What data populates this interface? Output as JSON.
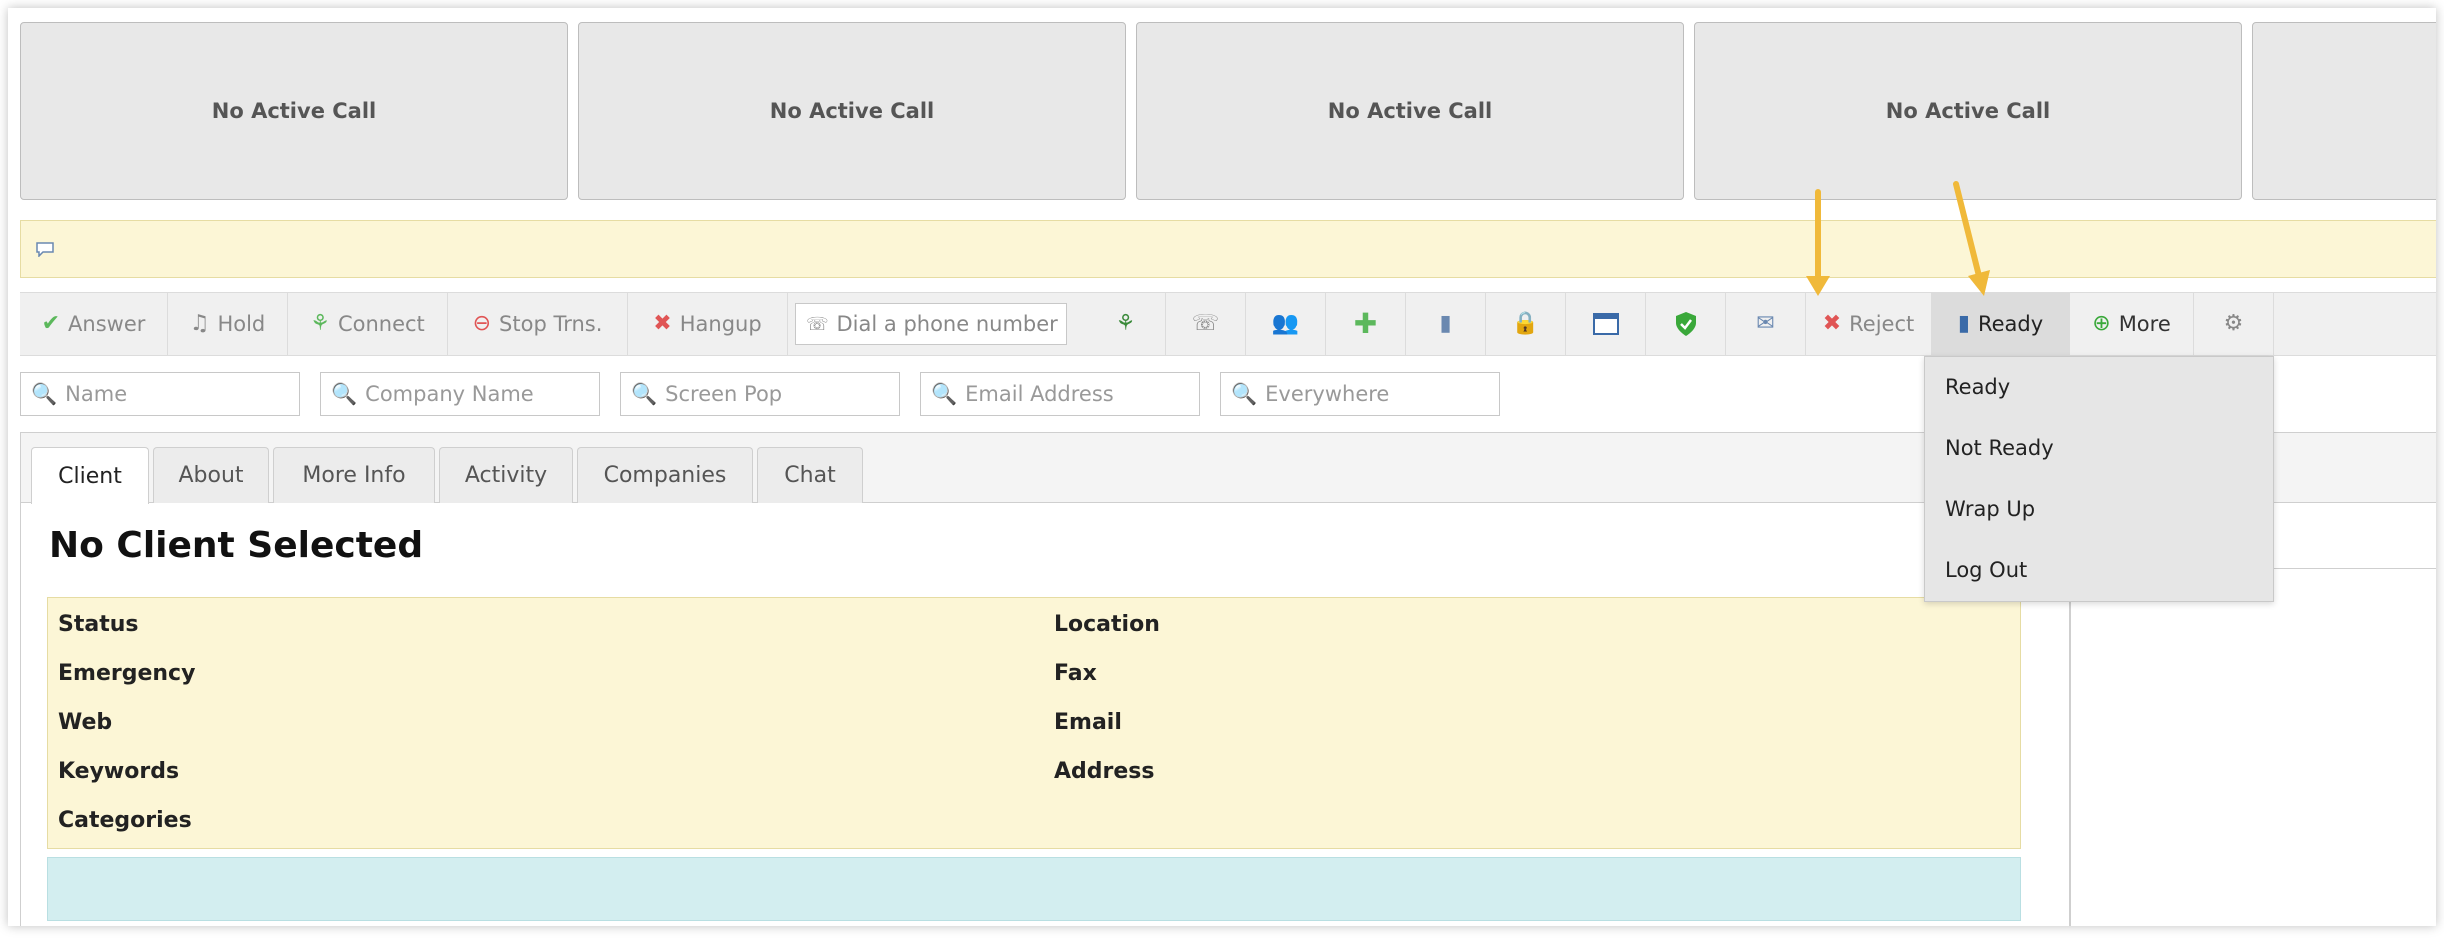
{
  "call_panels": [
    "No Active Call",
    "No Active Call",
    "No Active Call",
    "No Active Call"
  ],
  "toolbar": {
    "answer": "Answer",
    "hold": "Hold",
    "connect": "Connect",
    "stop_transfer": "Stop Trns.",
    "hangup": "Hangup",
    "dial_placeholder": "Dial a phone number",
    "reject": "Reject",
    "ready": "Ready",
    "more": "More"
  },
  "search": {
    "name": "Name",
    "company": "Company Name",
    "screen_pop": "Screen Pop",
    "email": "Email Address",
    "everywhere": "Everywhere"
  },
  "tabs": [
    "Client",
    "About",
    "More Info",
    "Activity",
    "Companies",
    "Chat"
  ],
  "client_title": "No Client Selected",
  "fields_left": [
    "Status",
    "Emergency",
    "Web",
    "Keywords",
    "Categories"
  ],
  "fields_right": [
    "Location",
    "Fax",
    "Email",
    "Address"
  ],
  "status_menu": [
    "Ready",
    "Not Ready",
    "Wrap Up",
    "Log Out"
  ],
  "colors": {
    "notice_bg": "#fcf6d6",
    "info_bg": "#fcf6d6",
    "cyan_bar": "#d3eef0",
    "arrow": "#f0b93a",
    "reject_red": "#e05555",
    "answer_green": "#5cb85c"
  }
}
